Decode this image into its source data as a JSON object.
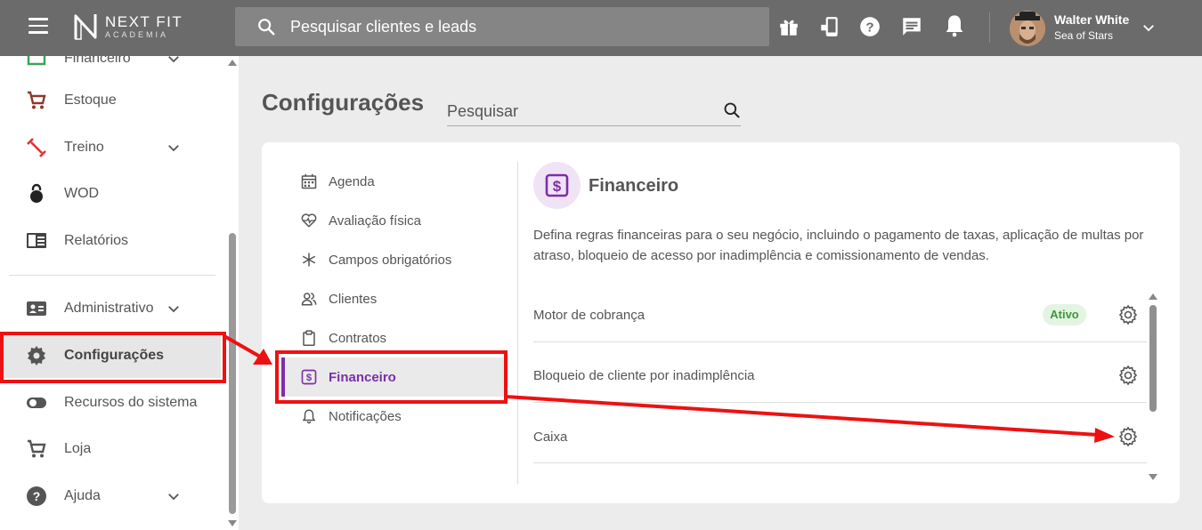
{
  "topbar": {
    "logo_main": "NEXT FIT",
    "logo_sub": "ACADEMIA",
    "search_placeholder": "Pesquisar clientes e leads",
    "user_name": "Walter White",
    "user_org": "Sea of Stars"
  },
  "sidebar": {
    "partial_top_label": "Financeiro",
    "items": [
      {
        "label": "Estoque"
      },
      {
        "label": "Treino"
      },
      {
        "label": "WOD"
      },
      {
        "label": "Relatórios"
      },
      {
        "label": "Administrativo"
      },
      {
        "label": "Configurações"
      },
      {
        "label": "Recursos do sistema"
      },
      {
        "label": "Loja"
      },
      {
        "label": "Ajuda"
      }
    ]
  },
  "page": {
    "title": "Configurações",
    "search_placeholder": "Pesquisar"
  },
  "settings_menu": [
    {
      "label": "Agenda"
    },
    {
      "label": "Avaliação física"
    },
    {
      "label": "Campos obrigatórios"
    },
    {
      "label": "Clientes"
    },
    {
      "label": "Contratos"
    },
    {
      "label": "Financeiro"
    },
    {
      "label": "Notificações"
    }
  ],
  "section": {
    "title": "Financeiro",
    "description": "Defina regras financeiras para o seu negócio, incluindo o pagamento de taxas, aplicação de multas por atraso, bloqueio de acesso por inadimplência e comissionamento de vendas.",
    "rows": [
      {
        "label": "Motor de cobrança",
        "status": "Ativo"
      },
      {
        "label": "Bloqueio de cliente por inadimplência"
      },
      {
        "label": "Caixa"
      }
    ]
  },
  "colors": {
    "topbar": "#6b6b6b",
    "accent": "#7b2fa8",
    "annotation": "#ee1111",
    "status_active": "#3a9a3a"
  }
}
